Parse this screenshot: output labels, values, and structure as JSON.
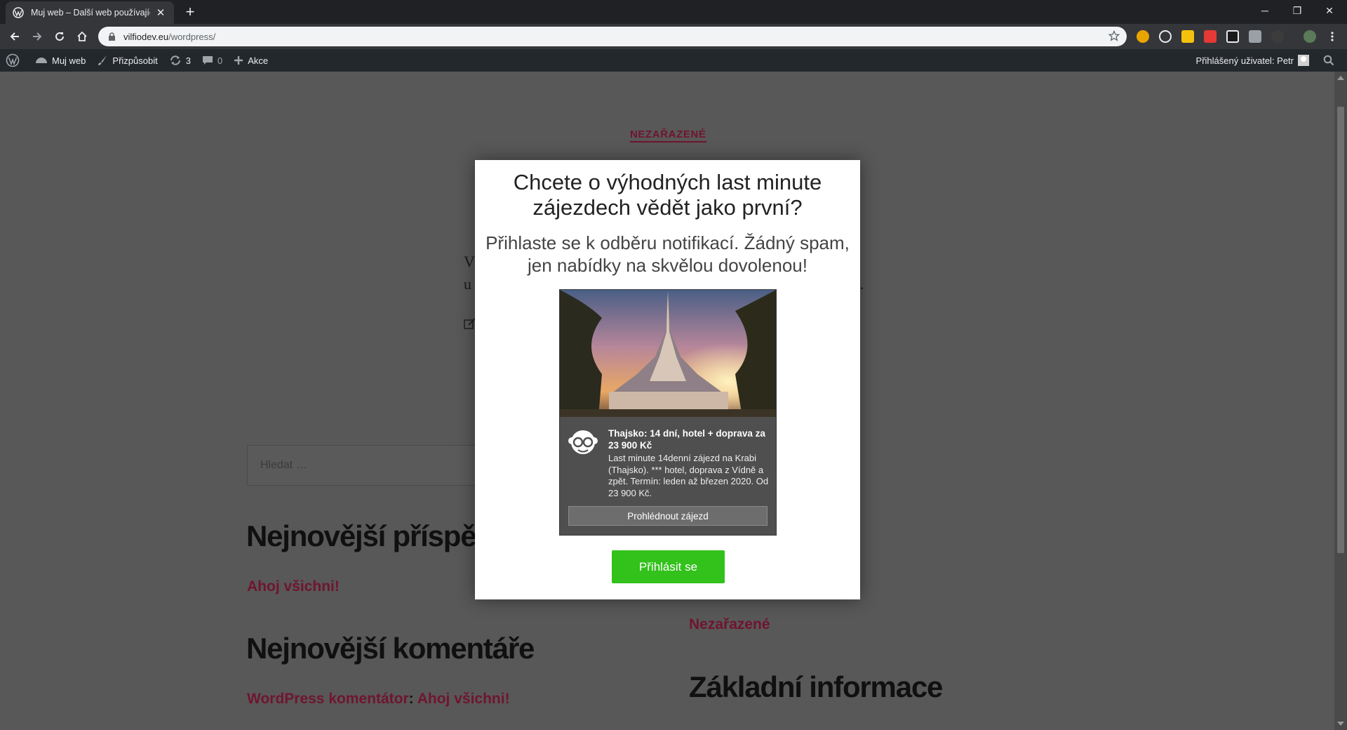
{
  "browser": {
    "tab_title": "Muj web – Další web používající WordPress",
    "url_host": "vilfiodev.eu",
    "url_path": "/wordpress/"
  },
  "adminbar": {
    "site_name": "Muj web",
    "customize": "Přizpůsobit",
    "updates_count": "3",
    "comments_count": "0",
    "new_label": "Akce",
    "user_greeting": "Přihlášený uživatel: Petr"
  },
  "page": {
    "category": "NEZAŘAZENÉ",
    "fragment_v": "V",
    "fragment_up": "u",
    "fragment_dot": ".",
    "search_placeholder": "Hledat …",
    "recent_posts_heading": "Nejnovější příspěvky",
    "recent_post": "Ahoj všichni!",
    "recent_comments_heading": "Nejnovější komentáře",
    "comment_author": "WordPress komentátor",
    "comment_sep": ":",
    "comment_post": "Ahoj všichni!",
    "category_link": "Nezařazené",
    "basic_info_heading": "Základní informace"
  },
  "modal": {
    "title": "Chcete o výhodných last minute zájezdech vědět jako první?",
    "subtitle": "Přihlaste se k odběru notifikací. Žádný spam, jen nabídky na skvělou dovolenou!",
    "card_title": "Thajsko: 14 dní, hotel + doprava za 23 900 Kč",
    "card_desc": "Last minute 14denní zájezd na Krabi (Thajsko). *** hotel, doprava z Vídně a zpět. Termín: leden až březen 2020. Od 23 900 Kč.",
    "card_button": "Prohlédnout zájezd",
    "cta": "Přihlásit se"
  },
  "colors": {
    "cta_green": "#33c11c",
    "link_maroon": "#6f1530",
    "admin_bar": "#23282d"
  }
}
